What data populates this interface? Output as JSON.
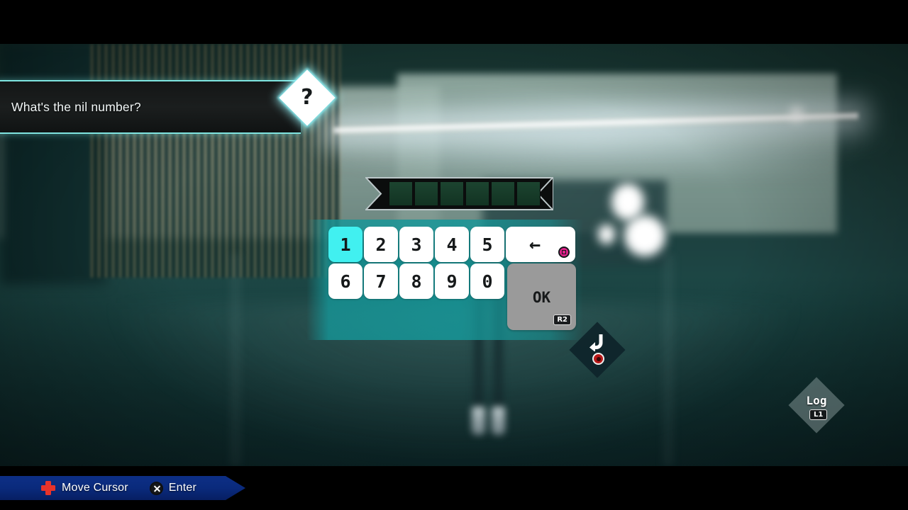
{
  "dialogue": {
    "text": "What's the nil number?",
    "marker": "?"
  },
  "answer": {
    "slot_count": 6,
    "values": [
      "",
      "",
      "",
      "",
      "",
      ""
    ]
  },
  "keypad": {
    "row1": [
      "1",
      "2",
      "3",
      "4",
      "5"
    ],
    "row2": [
      "6",
      "7",
      "8",
      "9",
      "0"
    ],
    "selected_key": "1",
    "backspace": {
      "glyph": "←",
      "button_icon": "square-button-icon"
    },
    "ok": {
      "label": "OK",
      "badge": "R2"
    }
  },
  "back_control": {
    "icon": "return-arrow-icon",
    "button_icon": "circle-button-icon"
  },
  "log_control": {
    "label": "Log",
    "badge": "L1"
  },
  "hint_bar": {
    "items": [
      {
        "icon": "dpad-icon",
        "label": "Move Cursor"
      },
      {
        "icon": "cross-button-icon",
        "label": "Enter"
      }
    ]
  },
  "colors": {
    "accent_cyan": "#41f0f0",
    "panel_teal": "#169698",
    "hint_blue": "#0d2f86",
    "dpad_red": "#e8332a",
    "square_pink": "#e0218a",
    "circle_red": "#b71818",
    "slot_green": "#1c4430"
  }
}
